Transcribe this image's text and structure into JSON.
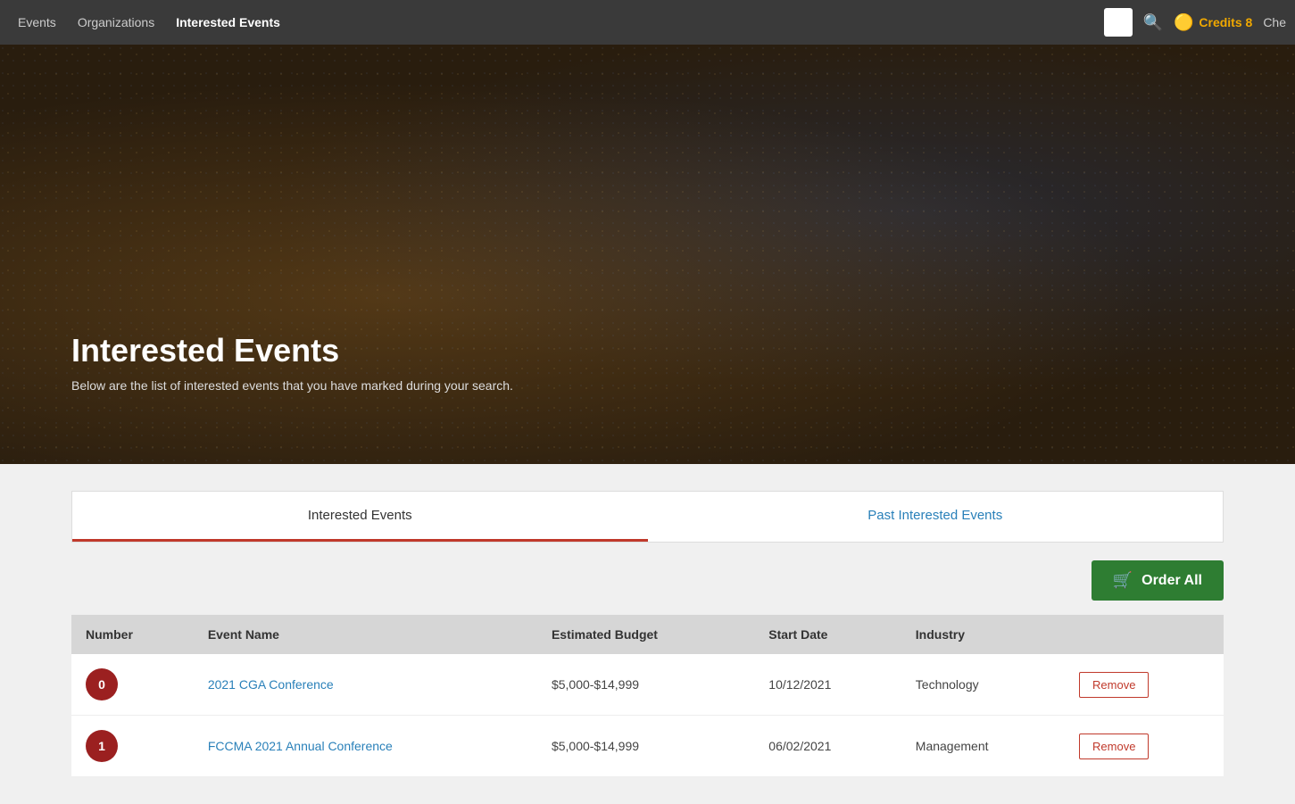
{
  "nav": {
    "links": [
      {
        "label": "Events",
        "active": false
      },
      {
        "label": "Organizations",
        "active": false
      },
      {
        "label": "Interested Events",
        "active": true
      }
    ],
    "credits_label": "Credits 8",
    "user_label": "Che",
    "search_icon": "🔍"
  },
  "hero": {
    "title": "Interested Events",
    "subtitle": "Below are the list of interested events that you have marked during your search."
  },
  "tabs": [
    {
      "label": "Interested Events",
      "active": true
    },
    {
      "label": "Past Interested Events",
      "active": false
    }
  ],
  "order_all_button": "Order All",
  "table": {
    "headers": [
      "Number",
      "Event Name",
      "Estimated Budget",
      "Start Date",
      "Industry",
      ""
    ],
    "rows": [
      {
        "number": "0",
        "event_name": "2021 CGA Conference",
        "budget": "$5,000-$14,999",
        "start_date": "10/12/2021",
        "industry": "Technology",
        "remove_label": "Remove"
      },
      {
        "number": "1",
        "event_name": "FCCMA 2021 Annual Conference",
        "budget": "$5,000-$14,999",
        "start_date": "06/02/2021",
        "industry": "Management",
        "remove_label": "Remove"
      }
    ]
  }
}
